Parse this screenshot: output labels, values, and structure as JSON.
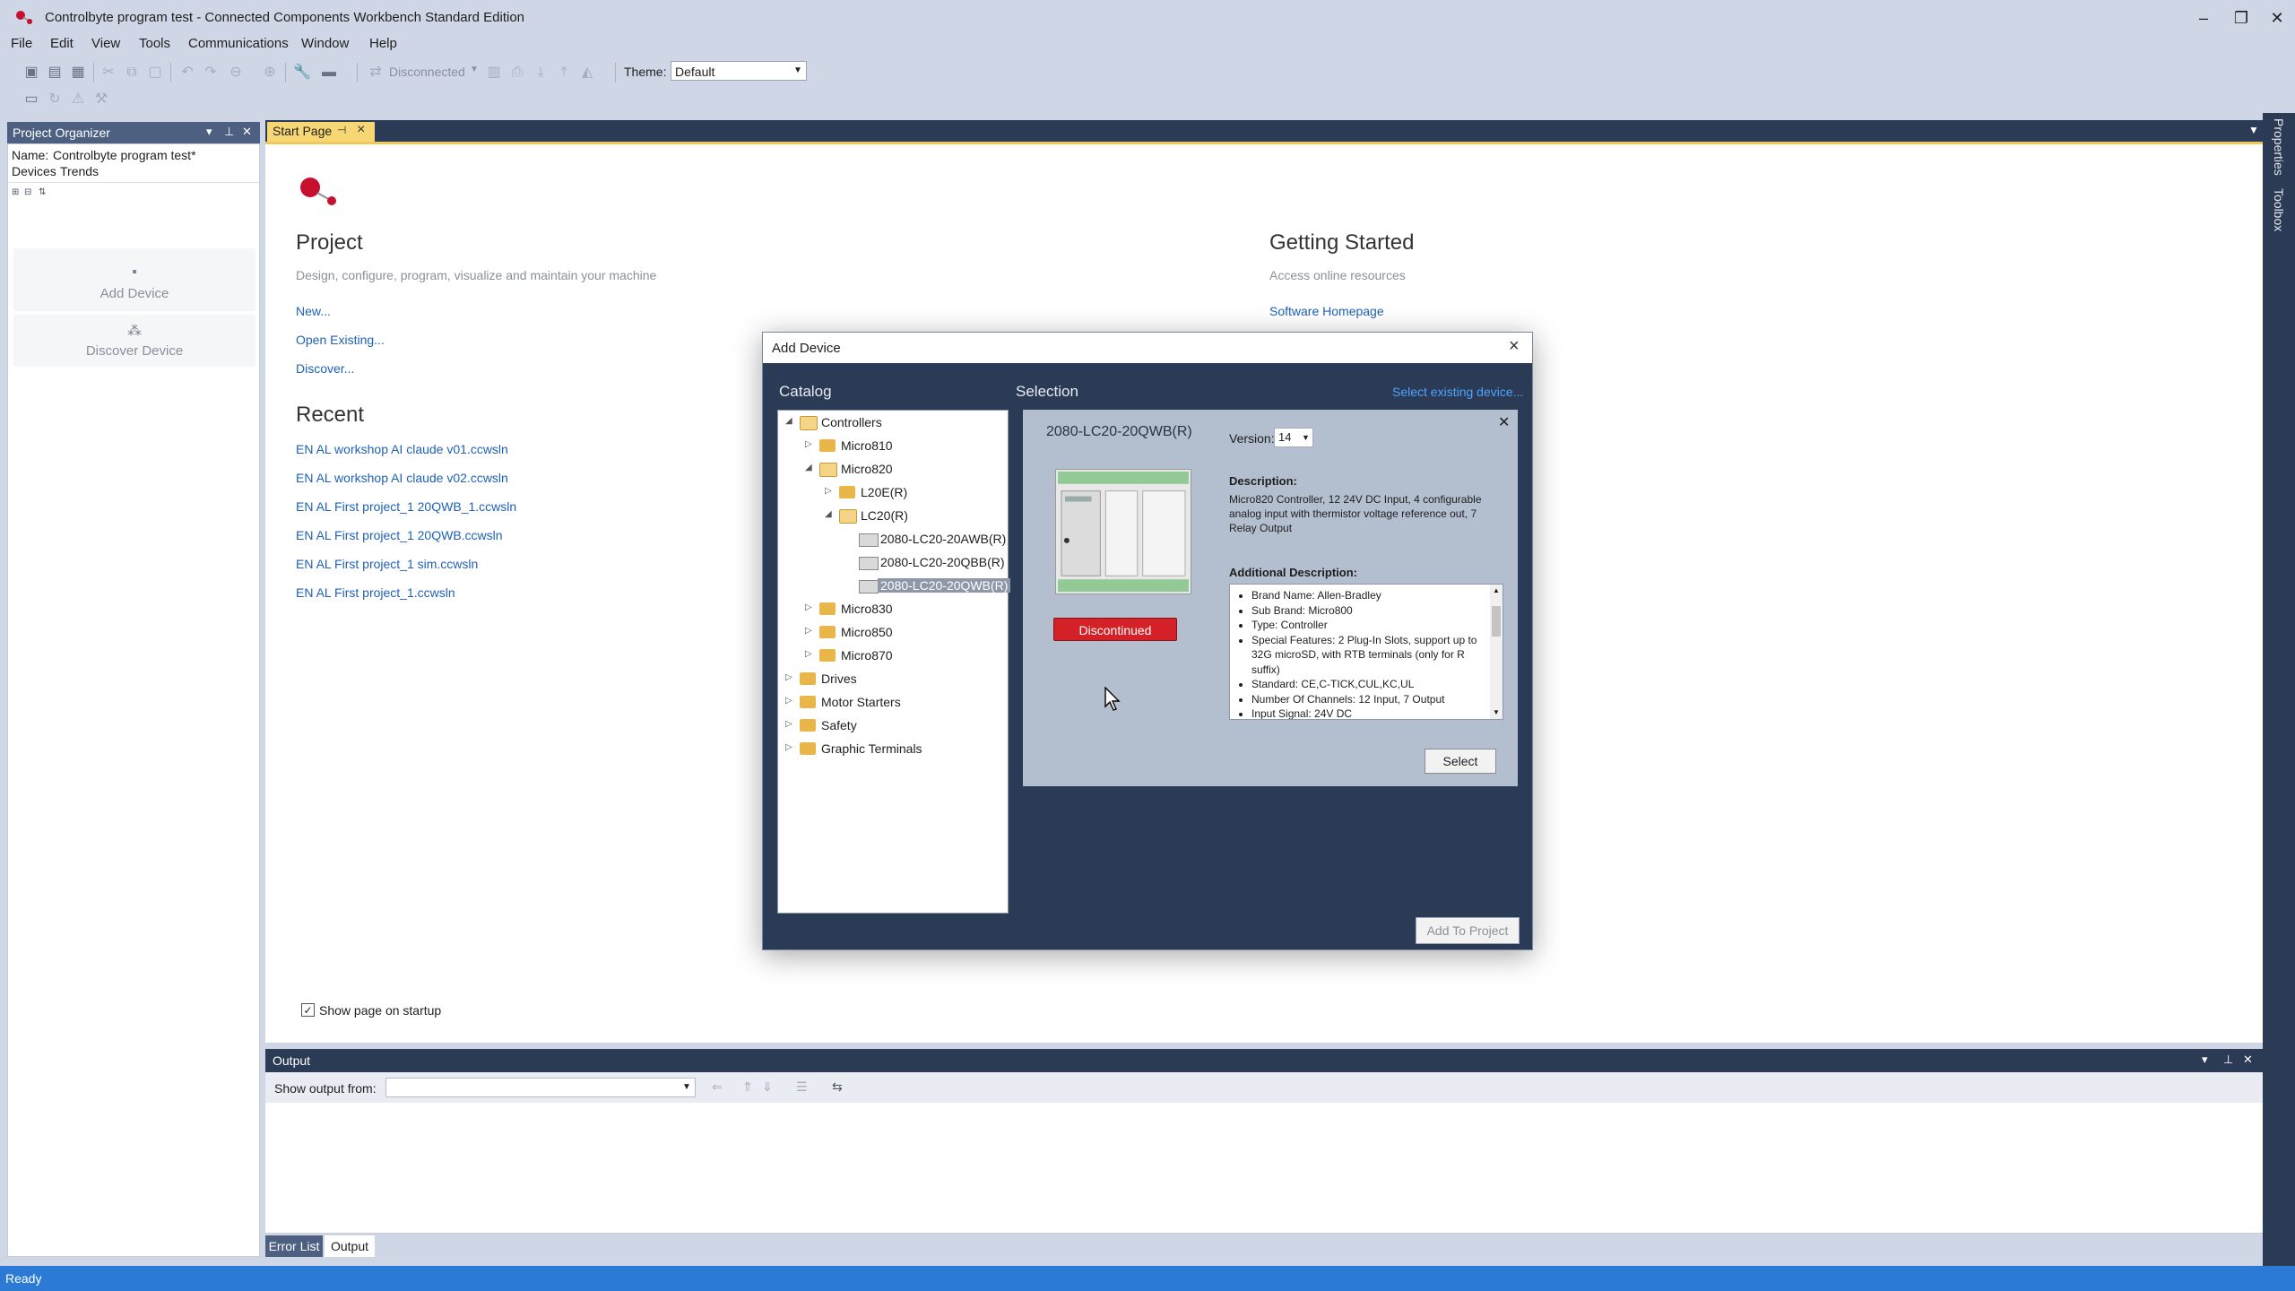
{
  "window": {
    "title": "Controlbyte program test - Connected Components Workbench Standard Edition",
    "minimize": "–",
    "restore": "❐",
    "close": "✕"
  },
  "menu": [
    "File",
    "Edit",
    "View",
    "Tools",
    "Communications",
    "Window",
    "Help"
  ],
  "toolbar": {
    "connection_status": "Disconnected",
    "theme_label": "Theme:",
    "theme_value": "Default"
  },
  "project_organizer": {
    "title": "Project Organizer",
    "name_label": "Name:",
    "name_value": "Controlbyte program test*",
    "tabs": [
      "Devices",
      "Trends"
    ],
    "add_device": "Add Device",
    "discover_device": "Discover Device"
  },
  "start_page": {
    "tab_label": "Start Page",
    "project_heading": "Project",
    "project_subtitle": "Design, configure, program, visualize and maintain your machine",
    "project_links": [
      "New...",
      "Open Existing...",
      "Discover..."
    ],
    "recent_heading": "Recent",
    "recent_files": [
      "EN AL workshop AI claude v01.ccwsln",
      "EN AL workshop AI claude v02.ccwsln",
      "EN AL First project_1 20QWB_1.ccwsln",
      "EN AL First project_1 20QWB.ccwsln",
      "EN AL First project_1 sim.ccwsln",
      "EN AL First project_1.ccwsln"
    ],
    "getting_started_heading": "Getting Started",
    "getting_started_subtitle": "Access online resources",
    "software_homepage": "Software Homepage",
    "show_on_startup": "Show page on startup",
    "show_on_startup_checked": true
  },
  "right_rail": [
    "Properties",
    "Toolbox"
  ],
  "add_device_dialog": {
    "title": "Add Device",
    "catalog_label": "Catalog",
    "selection_label": "Selection",
    "select_existing": "Select existing device...",
    "tree": [
      {
        "label": "Controllers",
        "level": 0,
        "expanded": true,
        "kind": "folder"
      },
      {
        "label": "Micro810",
        "level": 1,
        "expanded": false,
        "kind": "folder"
      },
      {
        "label": "Micro820",
        "level": 1,
        "expanded": true,
        "kind": "folder"
      },
      {
        "label": "L20E(R)",
        "level": 2,
        "expanded": false,
        "kind": "folder"
      },
      {
        "label": "LC20(R)",
        "level": 2,
        "expanded": true,
        "kind": "folder"
      },
      {
        "label": "2080-LC20-20AWB(R)",
        "level": 3,
        "kind": "device"
      },
      {
        "label": "2080-LC20-20QBB(R)",
        "level": 3,
        "kind": "device"
      },
      {
        "label": "2080-LC20-20QWB(R)",
        "level": 3,
        "kind": "device",
        "selected": true
      },
      {
        "label": "Micro830",
        "level": 1,
        "expanded": false,
        "kind": "folder"
      },
      {
        "label": "Micro850",
        "level": 1,
        "expanded": false,
        "kind": "folder"
      },
      {
        "label": "Micro870",
        "level": 1,
        "expanded": false,
        "kind": "folder"
      },
      {
        "label": "Drives",
        "level": 0,
        "expanded": false,
        "kind": "folder"
      },
      {
        "label": "Motor Starters",
        "level": 0,
        "expanded": false,
        "kind": "folder"
      },
      {
        "label": "Safety",
        "level": 0,
        "expanded": false,
        "kind": "folder"
      },
      {
        "label": "Graphic Terminals",
        "level": 0,
        "expanded": false,
        "kind": "folder"
      }
    ],
    "selection": {
      "name": "2080-LC20-20QWB(R)",
      "version_label": "Version:",
      "version_value": "14",
      "status_badge": "Discontinued",
      "description_heading": "Description:",
      "description": "Micro820 Controller, 12 24V DC Input, 4 configurable analog input with thermistor voltage reference out, 7 Relay Output",
      "additional_heading": "Additional Description:",
      "additional": [
        "Brand Name: Allen-Bradley",
        "Sub Brand: Micro800",
        "Type: Controller",
        "Special Features: 2 Plug-In Slots, support up to 32G microSD, with RTB terminals (only for R suffix)",
        "Standard: CE,C-TICK,CUL,KC,UL",
        "Number Of Channels: 12 Input, 7 Output",
        "Input Signal: 24V DC"
      ],
      "select_button": "Select"
    },
    "add_to_project": "Add To Project"
  },
  "output_panel": {
    "title": "Output",
    "show_output_from": "Show output from:",
    "tabs": [
      "Error List",
      "Output"
    ]
  },
  "status_bar": {
    "text": "Ready",
    "color": "#2b7bd6"
  },
  "colors": {
    "chrome": "#cfd6e5",
    "panel_dark": "#2b3a55",
    "tab_active": "#f7d774",
    "link": "#1f61b4",
    "discontinued": "#d42027"
  }
}
